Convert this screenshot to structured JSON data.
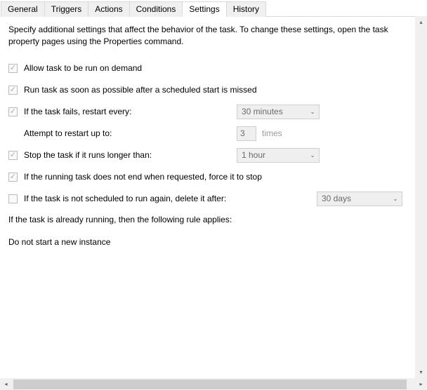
{
  "tabs": {
    "general": "General",
    "triggers": "Triggers",
    "actions": "Actions",
    "conditions": "Conditions",
    "settings": "Settings",
    "history": "History"
  },
  "desc": "Specify additional settings that affect the behavior of the task. To change these settings, open the task property pages using the Properties command.",
  "opt": {
    "allow_demand": "Allow task to be run on demand",
    "run_asap": "Run task as soon as possible after a scheduled start is missed",
    "restart_every": "If the task fails, restart every:",
    "restart_interval": "30 minutes",
    "attempt_label": "Attempt to restart up to:",
    "attempt_value": "3",
    "attempt_suffix": "times",
    "stop_longer": "Stop the task if it runs longer than:",
    "stop_duration": "1 hour",
    "force_stop": "If the running task does not end when requested, force it to stop",
    "delete_after": "If the task is not scheduled to run again, delete it after:",
    "delete_duration": "30 days"
  },
  "rule": {
    "heading": "If the task is already running, then the following rule applies:",
    "value": "Do not start a new instance"
  }
}
